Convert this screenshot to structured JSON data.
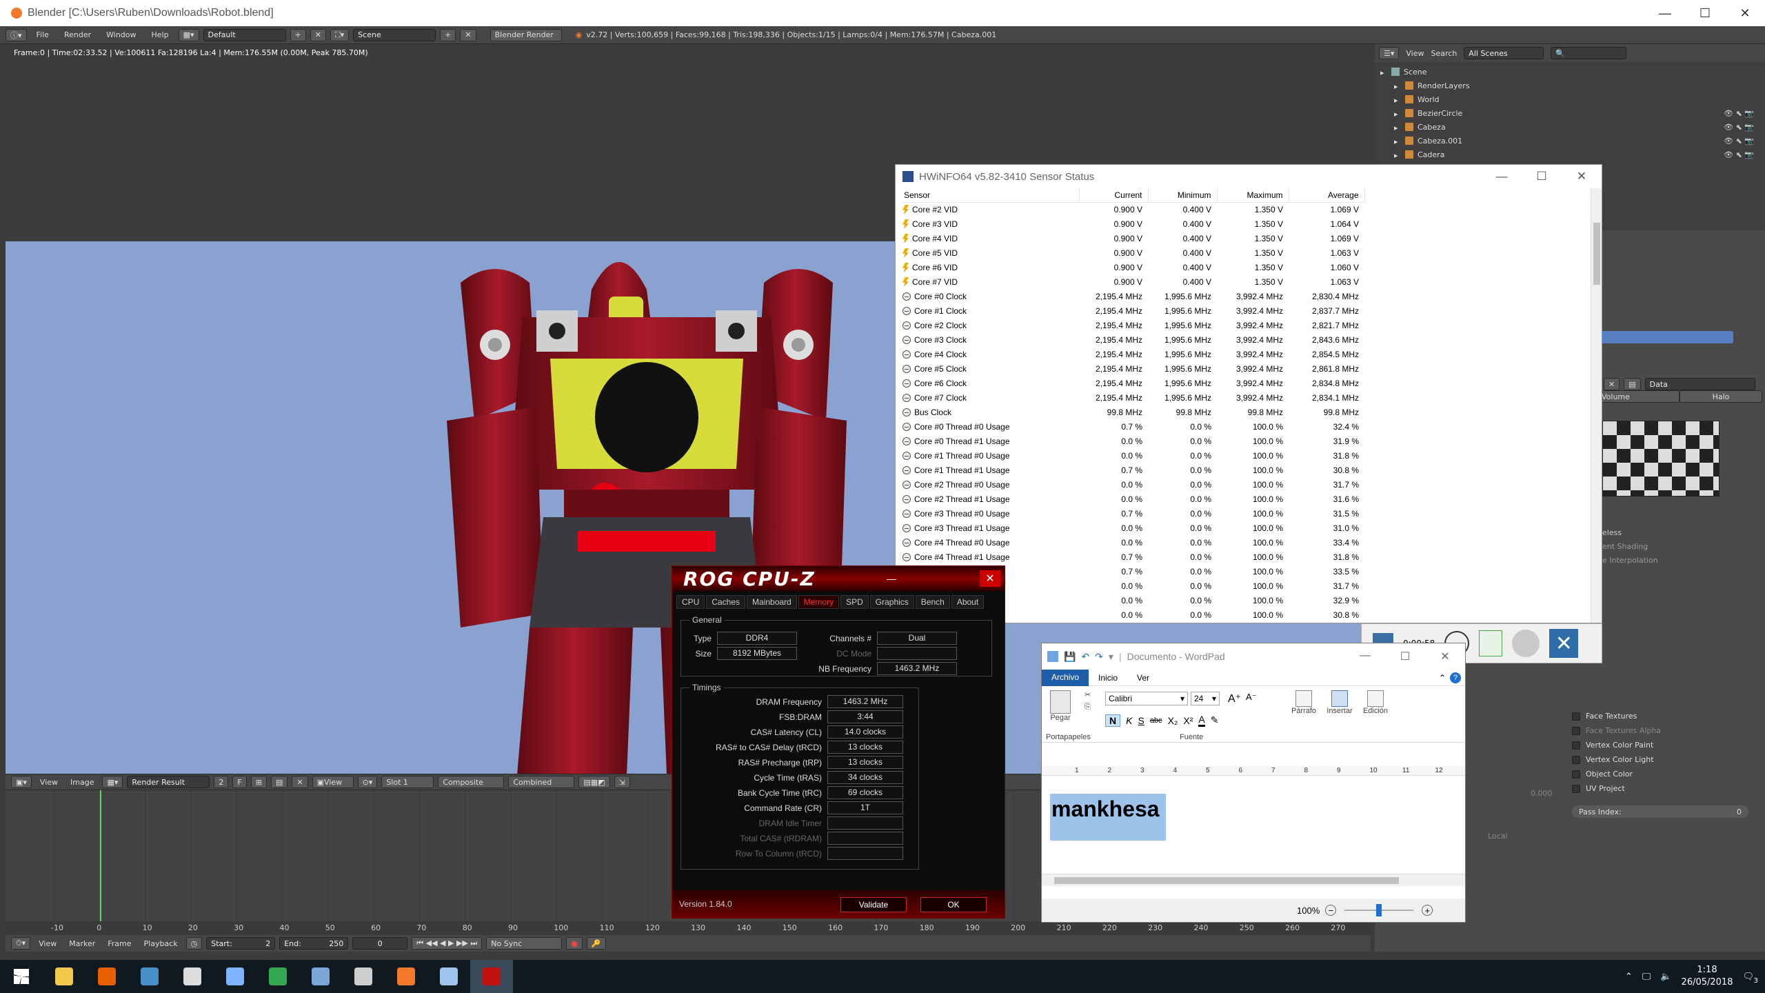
{
  "blender": {
    "title": "Blender [C:\\Users\\Ruben\\Downloads\\Robot.blend]",
    "menu": [
      "File",
      "Render",
      "Window",
      "Help"
    ],
    "layout": "Default",
    "scene": "Scene",
    "engine": "Blender Render",
    "stats": "v2.72 | Verts:100,659 | Faces:99,168 | Tris:198,336 | Objects:1/15 | Lamps:0/4 | Mem:176.57M | Cabeza.001",
    "render_info": "Frame:0 | Time:02:33.52 | Ve:100611 Fa:128196 La:4 | Mem:176.55M (0.00M, Peak 785.70M)",
    "image_bar": {
      "view": "View",
      "image": "Image",
      "render_result": "Render Result",
      "users": "2",
      "fake": "F",
      "view2": "View",
      "slot": "Slot 1",
      "composite": "Composite",
      "combined": "Combined"
    },
    "ruler_ticks": [
      "-10",
      "0",
      "10",
      "20",
      "30",
      "40",
      "50",
      "60",
      "70",
      "80",
      "90",
      "100",
      "110",
      "120",
      "130",
      "140",
      "150",
      "160",
      "170",
      "180",
      "190",
      "200",
      "210",
      "220",
      "230",
      "240",
      "250",
      "260",
      "270"
    ],
    "footer": {
      "view": "View",
      "marker": "Marker",
      "frame": "Frame",
      "playback": "Playback",
      "start": "Start:",
      "start_val": "2",
      "end": "End:",
      "end_val": "250",
      "current": "0",
      "sync": "No Sync"
    },
    "outliner": {
      "view": "View",
      "search": "Search",
      "filter": "All Scenes",
      "items": [
        {
          "label": "Scene",
          "indent": 0
        },
        {
          "label": "RenderLayers",
          "indent": 1
        },
        {
          "label": "World",
          "indent": 1
        },
        {
          "label": "BezierCircle",
          "indent": 1
        },
        {
          "label": "Cabeza",
          "indent": 1
        },
        {
          "label": "Cabeza.001",
          "indent": 1
        },
        {
          "label": "Cadera",
          "indent": 1
        }
      ]
    },
    "properties": {
      "data": "Data",
      "volume": "Volume",
      "halo": "Halo",
      "shadeless": "eless",
      "vertex_shading": "ent Shading",
      "interp": "e Interpolation",
      "checks": [
        "Face Textures",
        "Face Textures Alpha",
        "Vertex Color Paint",
        "Vertex Color Light",
        "Object Color",
        "UV Project"
      ],
      "pass_index": "Pass Index:",
      "pass_index_val": "0",
      "value": "0.000",
      "local": "Local"
    }
  },
  "hwinfo": {
    "title": "HWiNFO64 v5.82-3410 Sensor Status",
    "columns": [
      "Sensor",
      "Current",
      "Minimum",
      "Maximum",
      "Average"
    ],
    "rows": [
      {
        "icon": "volt",
        "name": "Core #2 VID",
        "cur": "0.900 V",
        "min": "0.400 V",
        "max": "1.350 V",
        "avg": "1.069 V"
      },
      {
        "icon": "volt",
        "name": "Core #3 VID",
        "cur": "0.900 V",
        "min": "0.400 V",
        "max": "1.350 V",
        "avg": "1.064 V"
      },
      {
        "icon": "volt",
        "name": "Core #4 VID",
        "cur": "0.900 V",
        "min": "0.400 V",
        "max": "1.350 V",
        "avg": "1.069 V"
      },
      {
        "icon": "volt",
        "name": "Core #5 VID",
        "cur": "0.900 V",
        "min": "0.400 V",
        "max": "1.350 V",
        "avg": "1.063 V"
      },
      {
        "icon": "volt",
        "name": "Core #6 VID",
        "cur": "0.900 V",
        "min": "0.400 V",
        "max": "1.350 V",
        "avg": "1.060 V"
      },
      {
        "icon": "volt",
        "name": "Core #7 VID",
        "cur": "0.900 V",
        "min": "0.400 V",
        "max": "1.350 V",
        "avg": "1.063 V"
      },
      {
        "icon": "clk",
        "name": "Core #0 Clock",
        "cur": "2,195.4 MHz",
        "min": "1,995.6 MHz",
        "max": "3,992.4 MHz",
        "avg": "2,830.4 MHz"
      },
      {
        "icon": "clk",
        "name": "Core #1 Clock",
        "cur": "2,195.4 MHz",
        "min": "1,995.6 MHz",
        "max": "3,992.4 MHz",
        "avg": "2,837.7 MHz"
      },
      {
        "icon": "clk",
        "name": "Core #2 Clock",
        "cur": "2,195.4 MHz",
        "min": "1,995.6 MHz",
        "max": "3,992.4 MHz",
        "avg": "2,821.7 MHz"
      },
      {
        "icon": "clk",
        "name": "Core #3 Clock",
        "cur": "2,195.4 MHz",
        "min": "1,995.6 MHz",
        "max": "3,992.4 MHz",
        "avg": "2,843.6 MHz"
      },
      {
        "icon": "clk",
        "name": "Core #4 Clock",
        "cur": "2,195.4 MHz",
        "min": "1,995.6 MHz",
        "max": "3,992.4 MHz",
        "avg": "2,854.5 MHz"
      },
      {
        "icon": "clk",
        "name": "Core #5 Clock",
        "cur": "2,195.4 MHz",
        "min": "1,995.6 MHz",
        "max": "3,992.4 MHz",
        "avg": "2,861.8 MHz"
      },
      {
        "icon": "clk",
        "name": "Core #6 Clock",
        "cur": "2,195.4 MHz",
        "min": "1,995.6 MHz",
        "max": "3,992.4 MHz",
        "avg": "2,834.8 MHz"
      },
      {
        "icon": "clk",
        "name": "Core #7 Clock",
        "cur": "2,195.4 MHz",
        "min": "1,995.6 MHz",
        "max": "3,992.4 MHz",
        "avg": "2,834.1 MHz"
      },
      {
        "icon": "clk",
        "name": "Bus Clock",
        "cur": "99.8 MHz",
        "min": "99.8 MHz",
        "max": "99.8 MHz",
        "avg": "99.8 MHz"
      },
      {
        "icon": "clk",
        "name": "Core #0 Thread #0 Usage",
        "cur": "0.7 %",
        "min": "0.0 %",
        "max": "100.0 %",
        "avg": "32.4 %"
      },
      {
        "icon": "clk",
        "name": "Core #0 Thread #1 Usage",
        "cur": "0.0 %",
        "min": "0.0 %",
        "max": "100.0 %",
        "avg": "31.9 %"
      },
      {
        "icon": "clk",
        "name": "Core #1 Thread #0 Usage",
        "cur": "0.0 %",
        "min": "0.0 %",
        "max": "100.0 %",
        "avg": "31.8 %"
      },
      {
        "icon": "clk",
        "name": "Core #1 Thread #1 Usage",
        "cur": "0.7 %",
        "min": "0.0 %",
        "max": "100.0 %",
        "avg": "30.8 %"
      },
      {
        "icon": "clk",
        "name": "Core #2 Thread #0 Usage",
        "cur": "0.0 %",
        "min": "0.0 %",
        "max": "100.0 %",
        "avg": "31.7 %"
      },
      {
        "icon": "clk",
        "name": "Core #2 Thread #1 Usage",
        "cur": "0.0 %",
        "min": "0.0 %",
        "max": "100.0 %",
        "avg": "31.6 %"
      },
      {
        "icon": "clk",
        "name": "Core #3 Thread #0 Usage",
        "cur": "0.7 %",
        "min": "0.0 %",
        "max": "100.0 %",
        "avg": "31.5 %"
      },
      {
        "icon": "clk",
        "name": "Core #3 Thread #1 Usage",
        "cur": "0.0 %",
        "min": "0.0 %",
        "max": "100.0 %",
        "avg": "31.0 %"
      },
      {
        "icon": "clk",
        "name": "Core #4 Thread #0 Usage",
        "cur": "0.0 %",
        "min": "0.0 %",
        "max": "100.0 %",
        "avg": "33.4 %"
      },
      {
        "icon": "clk",
        "name": "Core #4 Thread #1 Usage",
        "cur": "0.7 %",
        "min": "0.0 %",
        "max": "100.0 %",
        "avg": "31.8 %"
      },
      {
        "icon": "clk",
        "name": "age",
        "cur": "0.7 %",
        "min": "0.0 %",
        "max": "100.0 %",
        "avg": "33.5 %"
      },
      {
        "icon": "clk",
        "name": "age",
        "cur": "0.0 %",
        "min": "0.0 %",
        "max": "100.0 %",
        "avg": "31.7 %"
      },
      {
        "icon": "clk",
        "name": "age",
        "cur": "0.0 %",
        "min": "0.0 %",
        "max": "100.0 %",
        "avg": "32.9 %"
      },
      {
        "icon": "clk",
        "name": "age",
        "cur": "0.0 %",
        "min": "0.0 %",
        "max": "100.0 %",
        "avg": "30.8 %"
      }
    ],
    "timer": "0:00:58"
  },
  "cpuz": {
    "logo": "ROG CPU-Z",
    "tabs": [
      "CPU",
      "Caches",
      "Mainboard",
      "Memory",
      "SPD",
      "Graphics",
      "Bench",
      "About"
    ],
    "active_tab": "Memory",
    "general_label": "General",
    "type_label": "Type",
    "type": "DDR4",
    "size_label": "Size",
    "size": "8192 MBytes",
    "channels_label": "Channels #",
    "channels": "Dual",
    "dc_label": "DC Mode",
    "dc": "",
    "nb_label": "NB Frequency",
    "nb": "1463.2 MHz",
    "timings_label": "Timings",
    "timings": [
      {
        "label": "DRAM Frequency",
        "value": "1463.2 MHz",
        "dim": false
      },
      {
        "label": "FSB:DRAM",
        "value": "3:44",
        "dim": false
      },
      {
        "label": "CAS# Latency (CL)",
        "value": "14.0 clocks",
        "dim": false
      },
      {
        "label": "RAS# to CAS# Delay (tRCD)",
        "value": "13 clocks",
        "dim": false
      },
      {
        "label": "RAS# Precharge (tRP)",
        "value": "13 clocks",
        "dim": false
      },
      {
        "label": "Cycle Time (tRAS)",
        "value": "34 clocks",
        "dim": false
      },
      {
        "label": "Bank Cycle Time (tRC)",
        "value": "69 clocks",
        "dim": false
      },
      {
        "label": "Command Rate (CR)",
        "value": "1T",
        "dim": false
      },
      {
        "label": "DRAM Idle Timer",
        "value": "",
        "dim": true
      },
      {
        "label": "Total CAS# (tRDRAM)",
        "value": "",
        "dim": true
      },
      {
        "label": "Row To Column (tRCD)",
        "value": "",
        "dim": true
      }
    ],
    "version": "Version 1.84.0",
    "validate": "Validate",
    "ok": "OK"
  },
  "wordpad": {
    "title": "Documento - WordPad",
    "tabs": [
      "Archivo",
      "Inicio",
      "Ver"
    ],
    "paste": "Pegar",
    "clipboard_group": "Portapapeles",
    "font_group": "Fuente",
    "font": "Calibri",
    "size": "24",
    "paragraph": "Párrafo",
    "insert": "Insertar",
    "editing": "Edición",
    "ruler": [
      "1",
      "2",
      "3",
      "4",
      "5",
      "6",
      "7",
      "8",
      "9",
      "10",
      "11",
      "12"
    ],
    "text": "mankhesa",
    "zoom": "100%"
  },
  "taskbar": {
    "time": "1:18",
    "date": "26/05/2018",
    "notifications": "3",
    "apps": [
      {
        "name": "windows-start-icon",
        "color": "#ffffff"
      },
      {
        "name": "file-explorer-icon",
        "color": "#f2c94c"
      },
      {
        "name": "firefox-icon",
        "color": "#e66000"
      },
      {
        "name": "desktop-manager-icon",
        "color": "#4a90c8"
      },
      {
        "name": "obs-icon",
        "color": "#dddddd"
      },
      {
        "name": "app-arrow-icon",
        "color": "#7fb2ff"
      },
      {
        "name": "chrome-icon",
        "color": "#34a853"
      },
      {
        "name": "calculator-icon",
        "color": "#7aa7d8"
      },
      {
        "name": "folder-icon",
        "color": "#cfcfcf"
      },
      {
        "name": "blender-icon",
        "color": "#f5792a"
      },
      {
        "name": "wordpad-icon",
        "color": "#9ec5ee"
      },
      {
        "name": "cpuz-icon",
        "color": "#c01010"
      }
    ]
  }
}
